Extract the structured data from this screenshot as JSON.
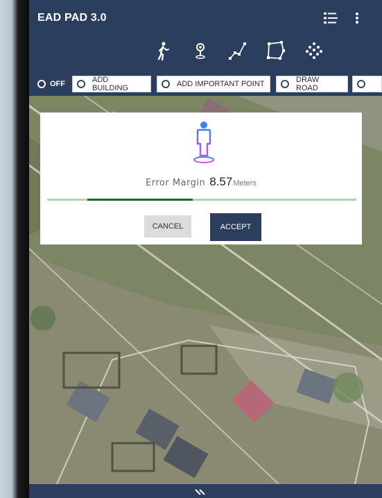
{
  "app": {
    "title": "EAD PAD 3.0"
  },
  "toolbar": {
    "icons": [
      "walk-icon",
      "location-pin-icon",
      "polyline-icon",
      "polygon-icon",
      "point-cloud-icon"
    ]
  },
  "modes": {
    "off_label": "OFF",
    "options": [
      {
        "label": "ADD BUILDING"
      },
      {
        "label": "ADD IMPORTANT POINT"
      },
      {
        "label": "DRAW ROAD"
      },
      {
        "label": ""
      }
    ]
  },
  "dialog": {
    "label": "Error Margin",
    "value": "8.57",
    "unit": "Meters",
    "cancel_label": "CANCEL",
    "accept_label": "ACCEPT"
  },
  "colors": {
    "appbar": "#2c3e5e",
    "progress_track": "#b4d1b4",
    "progress_fill": "#1e6b2e",
    "person_icon_top": "#3b82f6",
    "person_icon_bottom": "#d946ef"
  }
}
